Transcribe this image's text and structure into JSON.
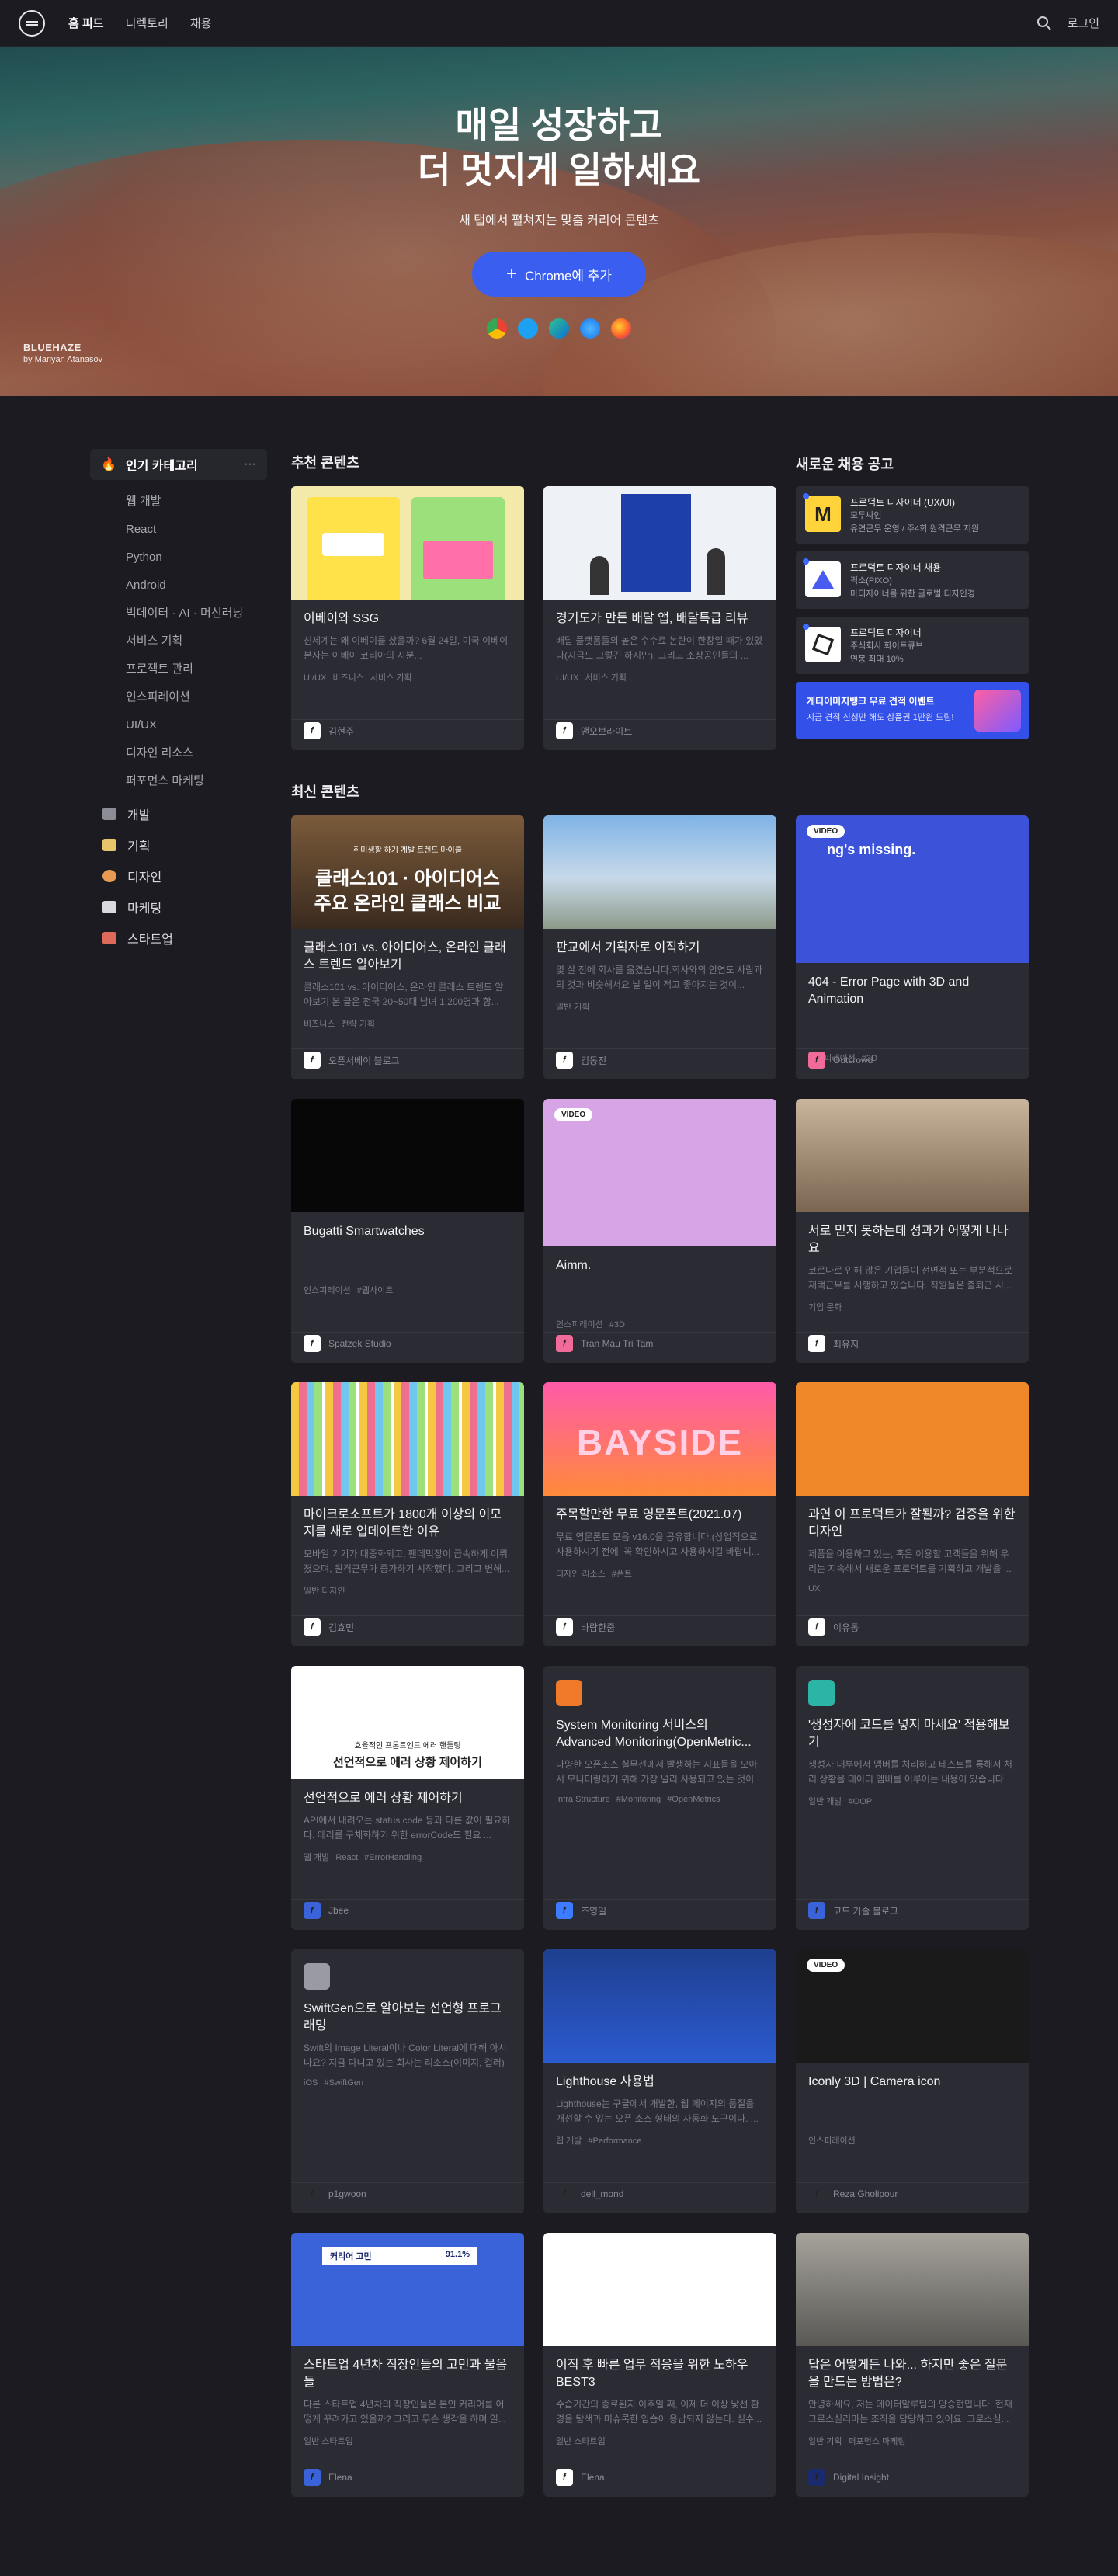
{
  "nav": {
    "links": [
      "홈 피드",
      "디렉토리",
      "채용"
    ],
    "search_icon": "search-icon",
    "login": "로그인"
  },
  "hero": {
    "title_line1": "매일 성장하고",
    "title_line2": "더 멋지게 일하세요",
    "subtitle": "새 탭에서 펼쳐지는 맞춤 커리어 콘텐츠",
    "cta": "Chrome에 추가",
    "browsers": [
      "chrome-icon",
      "twitter-icon",
      "edge-icon",
      "safari-icon",
      "firefox-icon"
    ],
    "credit_name": "BLUEHAZE",
    "credit_by": "by Mariyan Atanasov"
  },
  "sidebar": {
    "head": "인기 카테고리",
    "more": "···",
    "subcats": [
      "웹 개발",
      "React",
      "Python",
      "Android",
      "빅데이터 · AI · 머신러닝",
      "서비스 기획",
      "프로젝트 관리",
      "인스피레이션",
      "UI/UX",
      "디자인 리소스",
      "퍼포먼스 마케팅"
    ],
    "cats": [
      {
        "label": "개발",
        "color": "#8c8c96"
      },
      {
        "label": "기획",
        "color": "#e8c46a"
      },
      {
        "label": "디자인",
        "color": "#e89a54"
      },
      {
        "label": "마케팅",
        "color": "#d9d9de"
      },
      {
        "label": "스타트업",
        "color": "#e06a5a"
      }
    ]
  },
  "sections": {
    "recommended": "추천 콘텐츠",
    "jobs": "새로운 채용 공고",
    "latest": "최신 콘텐츠"
  },
  "recommended": [
    {
      "title": "이베이와 SSG",
      "desc": "신세계는 왜 이베이를 샀을까? 6월 24일, 미국 이베이 본사는 이베이 코리아의 지분...",
      "tags": [
        "UI/UX",
        "비즈니스",
        "서비스 기획"
      ],
      "author": "김현주"
    },
    {
      "title": "경기도가 만든 배달 앱, 배달특급 리뷰",
      "desc": "배달 플랫폼들의 높은 수수료 논란이 한창일 때가 있었다(지금도 그렇긴 하지만). 그리고 소상공인들의 ...",
      "tags": [
        "UI/UX",
        "서비스 기획"
      ],
      "author": "앤오브라이트"
    }
  ],
  "jobs": [
    {
      "title": "프로덕트 디자이너 (UX/UI)",
      "company": "모두싸인",
      "info": "유연근무 운영 / 주4회 원격근무 지원"
    },
    {
      "title": "프로덕트 디자이너 채용",
      "company": "픽소(PIXO)",
      "info": "마디자이너를 위한 글로벌 디자인경"
    },
    {
      "title": "프로덕트 디자이너",
      "company": "주식회사 화이트큐브",
      "info": "연봉 최대 10%"
    }
  ],
  "job_banner": {
    "title": "게티이미지뱅크 무료 견적 이벤트",
    "sub": "지금 견적 신청만 해도 상품권 1만원 드림!"
  },
  "latest": [
    {
      "title": "클래스101 vs. 아이디어스, 온라인 클래스 트렌드 알아보기",
      "desc": "클래스101 vs. 아이디어스, 온라인 클래스 트렌드 알아보기 본 글은 전국 20~50대 남녀 1,200명과 함...",
      "tags": [
        "비즈니스",
        "전략 기획"
      ],
      "author": "오픈서베이 블로그",
      "thumb_kicker": "취미생활 하기 계발 트렌드 마이클",
      "thumb_line1": "클래스101 · 아이디어스",
      "thumb_line2": "주요 온라인 클래스 비교"
    },
    {
      "title": "판교에서 기획자로 이직하기",
      "desc": "몇 살 전에 회사를 옮겼습니다.회사와의 인연도 사람과의 것과 비슷해서요 날 일이 적고 좋아지는 것이...",
      "tags": [
        "일반 기획"
      ],
      "author": "김동진"
    },
    {
      "title": "404 - Error Page with 3D and Animation",
      "desc": "",
      "tags": [
        "인스피레이션",
        "#3D"
      ],
      "author": "Outcrowd",
      "video": "VIDEO",
      "thumb_text": "ng's missing."
    },
    {
      "title": "Bugatti Smartwatches",
      "desc": "",
      "tags": [
        "인스피레이션",
        "#웹사이트"
      ],
      "author": "Spatzek Studio"
    },
    {
      "title": "Aimm.",
      "desc": "",
      "tags": [
        "인스피레이션",
        "#3D"
      ],
      "author": "Tran Mau Tri Tam",
      "video": "VIDEO"
    },
    {
      "title": "서로 믿지 못하는데 성과가 어떻게 나나요",
      "desc": "코로나로 인해 많은 기업들이 전면적 또는 부분적으로 재택근무를 시행하고 있습니다. 직원들은 출퇴근 시...",
      "tags": [
        "기업 문화"
      ],
      "author": "최유지"
    },
    {
      "title": "마이크로소프트가 1800개 이상의 이모지를 새로 업데이트한 이유",
      "desc": "모바일 기기가 대중화되고, 팬데믹장이 급속하게 이뤄졌으며, 원격근무가 증가하기 시작했다. 그리고 변해...",
      "tags": [
        "일반 디자인"
      ],
      "author": "김효민"
    },
    {
      "title": "주목할만한 무료 영문폰트(2021.07)",
      "desc": "무료 영문폰트 모음 v16.0을 공유합니다.(상업적으로 사용하시기 전에, 꼭 확인하시고 사용하시길 바랍니...",
      "tags": [
        "디자인 리소스",
        "#폰트"
      ],
      "author": "바람한줌",
      "thumb_text": "BAYSIDE"
    },
    {
      "title": "과연 이 프로덕트가 잘될까? 검증을 위한 디자인",
      "desc": "제품을 이용하고 있는, 혹은 이용할 고객들을 위해 우리는 지속해서 새로운 프로덕트를 기획하고 개발을 ...",
      "tags": [
        "UX"
      ],
      "author": "이유동"
    },
    {
      "title": "선언적으로 에러 상황 제어하기",
      "desc": "API에서 내려오는 status code 등과 다른 값이 필요하다. 에러를 구체화하기 위한 errorCode도 필요 ...",
      "tags": [
        "웹 개발",
        "React",
        "#ErrorHandling"
      ],
      "author": "Jbee",
      "thumb_kicker": "효율적인 프론트엔드 에러 핸들링",
      "thumb_line1": "선언적으로 에러 상황 제어하기"
    },
    {
      "title": "System Monitoring 서비스의 Advanced Monitoring(OpenMetric...",
      "desc": "다양한 오픈소스 실무선에서 발생하는 지표들을 모아서 모니터링하기 위해 가장 널리 사용되고 있는 것이 Prometheus라는 오픈소스 실무선입니다...",
      "tags": [
        "Infra Structure",
        "#Monitoring",
        "#OpenMetrics"
      ],
      "author": "조영일"
    },
    {
      "title": "'생성자에 코드를 넣지 마세요' 적용해보기",
      "desc": "생성자 내부에서 멤버를 처리하고 테스트를 통해서 처리 상황을 데이터 멤버를 이루어는 내용이 있습니다. 하지만 여러 제가 작성했던 코드가 뭐던 생각나서 개선...",
      "tags": [
        "일반 개발",
        "#OOP"
      ],
      "author": "코드 기술 블로그"
    },
    {
      "title": "SwiftGen으로 알아보는 선언형 프로그래밍",
      "desc": "Swift의 Image Literal이나 Color Literal에 대해 아시나요? 지금 다니고 있는 회사는 리소스(이미지, 컬러)를 에셋 카탈로그(xcasset)로 관리하고 Image...",
      "tags": [
        "iOS",
        "#SwiftGen"
      ],
      "author": "p1gwoon"
    },
    {
      "title": "Lighthouse 사용법",
      "desc": "Lighthouse는 구글에서 개발한, 웹 페이지의 품질을 개선할 수 있는 오픈 소스 형태의 자동화 도구이다. ...",
      "tags": [
        "웹 개발",
        "#Performance"
      ],
      "author": "dell_mond"
    },
    {
      "title": "Iconly 3D | Camera icon",
      "desc": "",
      "tags": [
        "인스피레이션"
      ],
      "author": "Reza Gholipour",
      "video": "VIDEO"
    },
    {
      "title": "스타트업 4년차 직장인들의 고민과 물음들",
      "desc": "다른 스타트업 4년차의 직장인들은 본인 커리어를 어떻게 꾸려가고 있을까? 그리고 무슨 생각을 하며 일...",
      "tags": [
        "일반 스타트업"
      ],
      "author": "Elena",
      "thumb_kicker": "커리어 고민",
      "thumb_value": "91.1%"
    },
    {
      "title": "이직 후 빠른 업무 적응을 위한 노하우 BEST3",
      "desc": "수습기간의 종료된지 이주일 째, 이제 더 이상 낯선 환경을 탐색과 머슈록한 임습이 용납되지 않는다. 실수...",
      "tags": [
        "일반 스타트업"
      ],
      "author": "Elena"
    },
    {
      "title": "답은 어떻게든 나와... 하지만 좋은 질문을 만드는 방법은?",
      "desc": "안녕하세요, 저는 데이터알루팀의 양승현입니다. 현재 그로스실리마는 조직을 담당하고 있어요. 그로스실...",
      "tags": [
        "일반 기획",
        "퍼포먼스 마케팅"
      ],
      "author": "Digital Insight"
    }
  ]
}
